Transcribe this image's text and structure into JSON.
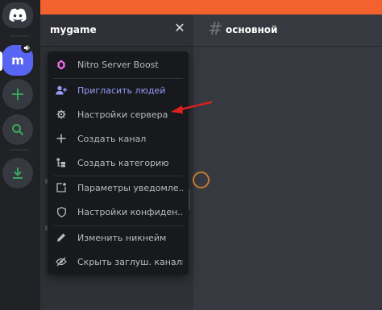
{
  "window": {
    "accent_bar_color": "#f2612e"
  },
  "server_rail": {
    "logo_icon": "discord-logo-icon",
    "servers": [
      {
        "label": "m",
        "icon": "speaker-icon",
        "selected": true
      }
    ],
    "buttons": [
      {
        "icon": "plus-icon",
        "color": "#3ba55d"
      },
      {
        "icon": "search-icon",
        "color": "#3ba55d"
      },
      {
        "icon": "download-icon",
        "color": "#3ba55d"
      }
    ]
  },
  "sidebar": {
    "server_name": "mygame",
    "close_symbol": "✕"
  },
  "server_menu": {
    "items": [
      {
        "label": "Nitro Server Boost",
        "icon": "boost-gem-icon"
      },
      {
        "label": "Пригласить людей",
        "icon": "add-user-icon",
        "highlight": true
      },
      {
        "label": "Настройки сервера",
        "icon": "gear-icon"
      },
      {
        "label": "Создать канал",
        "icon": "plus-icon"
      },
      {
        "label": "Создать категорию",
        "icon": "category-icon"
      },
      {
        "label": "Параметры уведомле...",
        "icon": "notification-icon"
      },
      {
        "label": "Настройки конфиден...",
        "icon": "shield-icon"
      },
      {
        "label": "Изменить никнейм",
        "icon": "pencil-icon"
      },
      {
        "label": "Скрыть заглуш. каналы",
        "icon": "eye-slash-icon"
      }
    ]
  },
  "main": {
    "channel_name": "основной",
    "channel_icon": "hash-icon"
  },
  "annotation": {
    "arrow_color": "#e02020"
  }
}
